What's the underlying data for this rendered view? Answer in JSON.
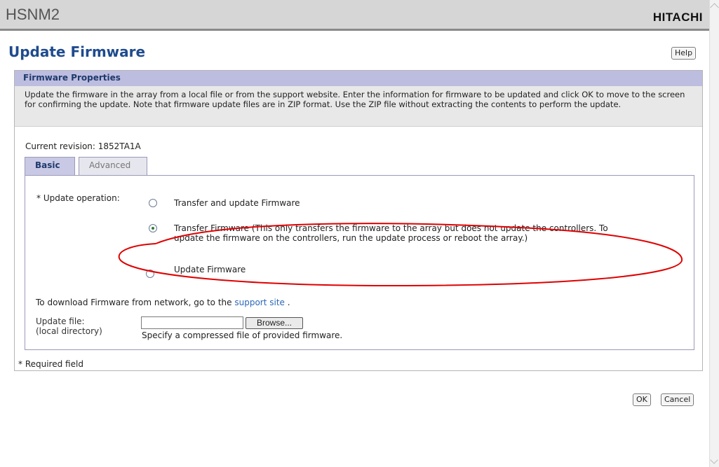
{
  "header": {
    "app_title": "HSNM2",
    "brand": "HITACHI"
  },
  "page": {
    "title": "Update Firmware",
    "help_label": "Help"
  },
  "section": {
    "title": "Firmware Properties",
    "description": "Update the firmware in the array from a local file or from the support website.  Enter the information for firmware to be updated and click OK to move to the screen for confirming the update.  Note that firmware update files are in ZIP format. Use the ZIP file without extracting the contents to perform the update."
  },
  "current_revision": "Current revision: 1852TA1A",
  "tabs": [
    {
      "label": "Basic",
      "selected": true
    },
    {
      "label": "Advanced",
      "selected": false
    }
  ],
  "update_operation": {
    "label": "* Update operation:",
    "options": [
      {
        "label": "Transfer and update Firmware",
        "selected": false
      },
      {
        "label": "Transfer Firmware (This only transfers the firmware to the array but does not update the controllers. To update the firmware on the controllers, run the update process or reboot the array.)",
        "selected": true
      },
      {
        "label": "Update Firmware",
        "selected": false
      }
    ]
  },
  "network": {
    "text": "To download Firmware from network, go to the",
    "link": "support site",
    "suffix": "."
  },
  "update_file": {
    "label_line1": "Update file:",
    "label_line2": "(local directory)",
    "value": "",
    "browse_label": "Browse...",
    "hint": "Specify a compressed file of provided firmware."
  },
  "required_note": "* Required field",
  "actions": {
    "ok_label": "OK",
    "cancel_label": "Cancel"
  },
  "colors": {
    "title_blue": "#1f4b8e",
    "header_lavender": "#bdbde0",
    "annotation_red": "#e00000"
  }
}
